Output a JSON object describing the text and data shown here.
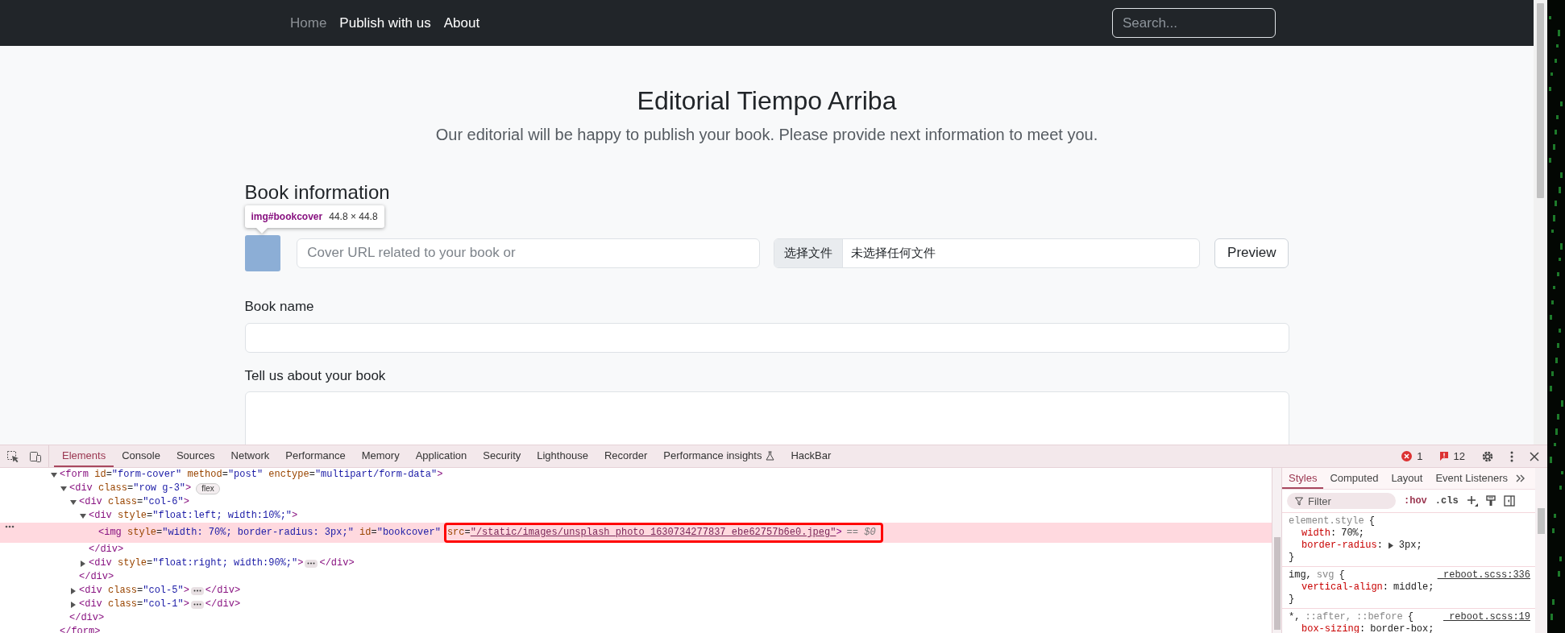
{
  "browser_page": {
    "navbar": {
      "links": [
        {
          "label": "Home",
          "dimmed": true
        },
        {
          "label": "Publish with us",
          "dimmed": false
        },
        {
          "label": "About",
          "dimmed": false
        }
      ],
      "search": {
        "placeholder": "Search..."
      }
    },
    "header": {
      "title": "Editorial Tiempo Arriba",
      "subtitle": "Our editorial will be happy to publish your book. Please provide next information to meet you."
    },
    "form": {
      "section_title": "Book information",
      "inspect_tooltip": {
        "selector": "img#bookcover",
        "size": "44.8 × 44.8"
      },
      "cover": {
        "url_placeholder": "Cover URL related to your book or",
        "file_button": "选择文件",
        "file_status": "未选择任何文件",
        "preview_button": "Preview"
      },
      "fields": [
        {
          "label": "Book name",
          "kind": "input"
        },
        {
          "label": "Tell us about your book",
          "kind": "textarea"
        }
      ]
    }
  },
  "devtools": {
    "tabs": [
      {
        "label": "Elements",
        "selected": true,
        "kind": "plain"
      },
      {
        "label": "Console",
        "selected": false,
        "kind": "plain"
      },
      {
        "label": "Sources",
        "selected": false,
        "kind": "plain"
      },
      {
        "label": "Network",
        "selected": false,
        "kind": "plain"
      },
      {
        "label": "Performance",
        "selected": false,
        "kind": "plain"
      },
      {
        "label": "Memory",
        "selected": false,
        "kind": "plain"
      },
      {
        "label": "Application",
        "selected": false,
        "kind": "plain"
      },
      {
        "label": "Security",
        "selected": false,
        "kind": "plain"
      },
      {
        "label": "Lighthouse",
        "selected": false,
        "kind": "plain"
      },
      {
        "label": "Recorder",
        "selected": false,
        "kind": "plain"
      },
      {
        "label": "Performance insights",
        "selected": false,
        "kind": "experiment"
      },
      {
        "label": "HackBar",
        "selected": false,
        "kind": "plain"
      }
    ],
    "error_count": "1",
    "message_count": "12",
    "dom_tree": [
      {
        "kind": "element",
        "markup": "<form id=\"form-cover\" method=\"post\" enctype=\"multipart/form-data\">",
        "expanded": true,
        "selected": false,
        "closing": "</form>",
        "children": [
          {
            "kind": "element",
            "markup": "<div class=\"row g-3\">",
            "badge": "flex",
            "expanded": true,
            "selected": false,
            "closing": "</div>",
            "children": [
              {
                "kind": "element",
                "markup": "<div class=\"col-6\">",
                "expanded": true,
                "selected": false,
                "closing": "</div>",
                "children": [
                  {
                    "kind": "element",
                    "markup": "<div style=\"float:left; width:10%;\">",
                    "expanded": true,
                    "selected": false,
                    "closing": "</div>",
                    "children": [
                      {
                        "kind": "leaf",
                        "markup": "<img style=\"width: 70%; border-radius: 3px;\" id=\"bookcover\"",
                        "boxed": "src=\"/static/images/unsplash_photo_1630734277837_ebe62757b6e0.jpeg\">",
                        "console_ref": "== $0",
                        "selected": true
                      }
                    ]
                  },
                  {
                    "kind": "element",
                    "markup": "<div style=\"float:right; width:90%;\">",
                    "expanded": false,
                    "selected": false,
                    "closing": "</div>"
                  }
                ]
              },
              {
                "kind": "element",
                "markup": "<div class=\"col-5\">",
                "expanded": false,
                "selected": false,
                "closing": "</div>"
              },
              {
                "kind": "element",
                "markup": "<div class=\"col-1\">",
                "expanded": false,
                "selected": false,
                "closing": "</div>"
              }
            ]
          }
        ]
      }
    ],
    "styles": {
      "tabs": [
        {
          "label": "Styles",
          "selected": true
        },
        {
          "label": "Computed",
          "selected": false
        },
        {
          "label": "Layout",
          "selected": false
        },
        {
          "label": "Event Listeners",
          "selected": false
        }
      ],
      "filter_placeholder": "Filter",
      "toggles": [
        ":hov",
        ".cls"
      ],
      "rules": [
        {
          "selectors": [
            {
              "text": "element.style",
              "matches": false
            },
            {
              "text": "{",
              "matches": true
            }
          ],
          "declarations": [
            {
              "text": "width: 70%;",
              "expandable": false
            },
            {
              "text": "border-radius: 3px;",
              "expandable": true
            }
          ],
          "closing": "}"
        },
        {
          "selectors": [
            {
              "text": "img,",
              "matches": true
            },
            {
              "text": "svg",
              "matches": false
            },
            {
              "text": "{",
              "matches": true
            }
          ],
          "source": "_reboot.scss:336",
          "declarations": [
            {
              "text": "vertical-align: middle;",
              "expandable": false
            }
          ],
          "closing": "}"
        },
        {
          "selectors": [
            {
              "text": "*,",
              "matches": true
            },
            {
              "text": "::after,",
              "matches": false
            },
            {
              "text": "::before",
              "matches": false
            },
            {
              "text": "{",
              "matches": true
            }
          ],
          "source": "_reboot.scss:19",
          "declarations": [
            {
              "text": "box-sizing: border-box;",
              "expandable": false
            }
          ]
        }
      ]
    }
  }
}
